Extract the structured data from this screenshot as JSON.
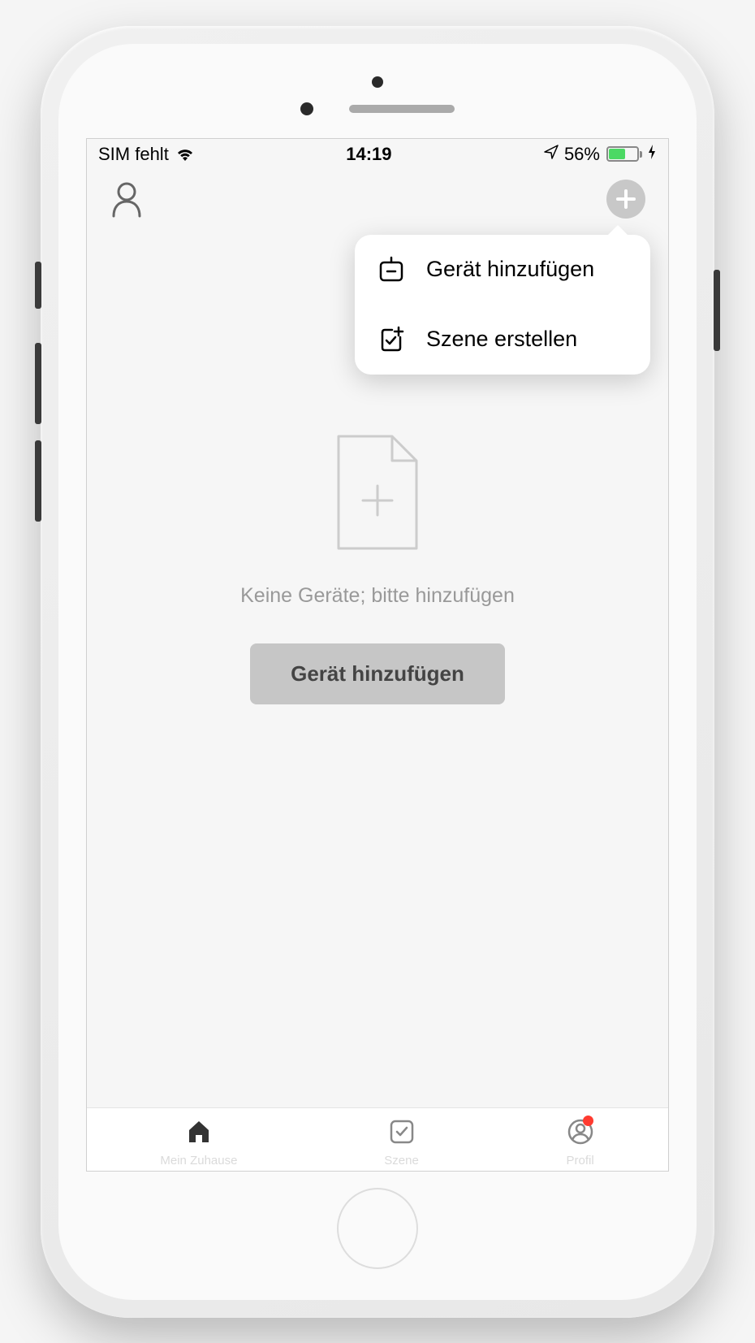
{
  "status_bar": {
    "sim_text": "SIM fehlt",
    "time": "14:19",
    "battery_percent": "56%"
  },
  "dropdown": {
    "items": [
      {
        "label": "Gerät hinzufügen"
      },
      {
        "label": "Szene erstellen"
      }
    ]
  },
  "empty_state": {
    "message": "Keine Geräte; bitte hinzufügen",
    "button_label": "Gerät hinzufügen"
  },
  "bottom_nav": {
    "items": [
      {
        "label": "Mein Zuhause"
      },
      {
        "label": "Szene"
      },
      {
        "label": "Profil"
      }
    ]
  }
}
